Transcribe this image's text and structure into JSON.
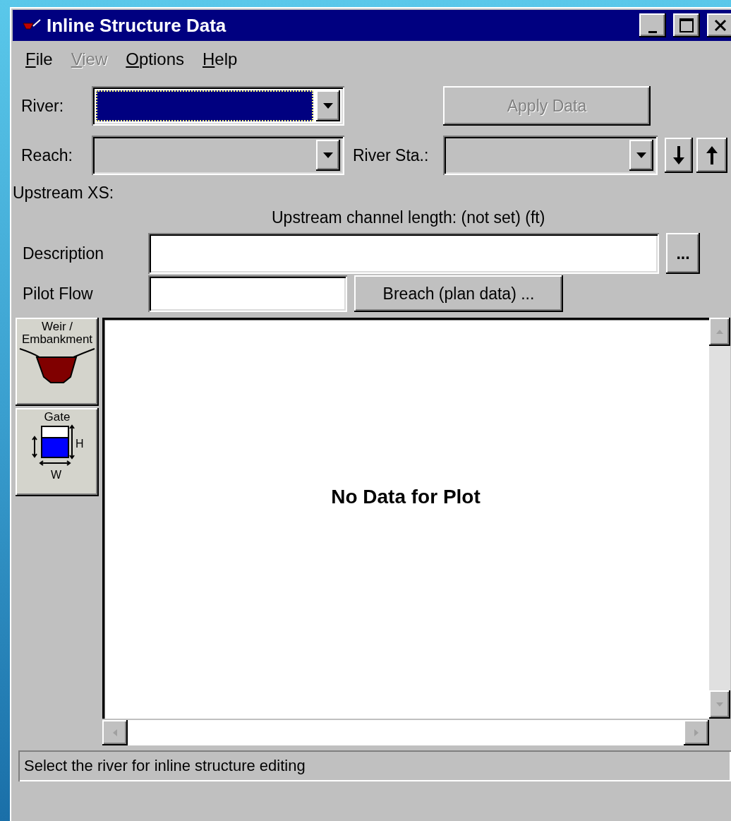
{
  "window": {
    "title": "Inline Structure Data"
  },
  "menu": [
    {
      "label": "File",
      "disabled": false
    },
    {
      "label": "View",
      "disabled": true
    },
    {
      "label": "Options",
      "disabled": false
    },
    {
      "label": "Help",
      "disabled": false
    }
  ],
  "river": {
    "label": "River:",
    "focused": true,
    "disabled": false
  },
  "apply_button": {
    "label": "Apply Data",
    "disabled": true
  },
  "reach": {
    "label": "Reach:",
    "focused": false,
    "disabled": true
  },
  "river_station": {
    "label": "River Sta.:",
    "focused": false,
    "disabled": true
  },
  "upstream_xs": {
    "label": "Upstream XS:"
  },
  "upstream_length": "Upstream channel length: (not set) (ft)",
  "description": {
    "label": "Description",
    "button": "..."
  },
  "pilot_flow": {
    "label": "Pilot Flow"
  },
  "breach_button": "Breach (plan data) ...",
  "side_buttons": [
    {
      "kind": "weir",
      "label": "Weir /\nEmbankment"
    },
    {
      "kind": "gate",
      "label": "Gate",
      "height_label": "H",
      "width_label": "W"
    }
  ],
  "plot": {
    "message": "No Data for Plot"
  },
  "status_bar": "Select the river for inline structure editing"
}
